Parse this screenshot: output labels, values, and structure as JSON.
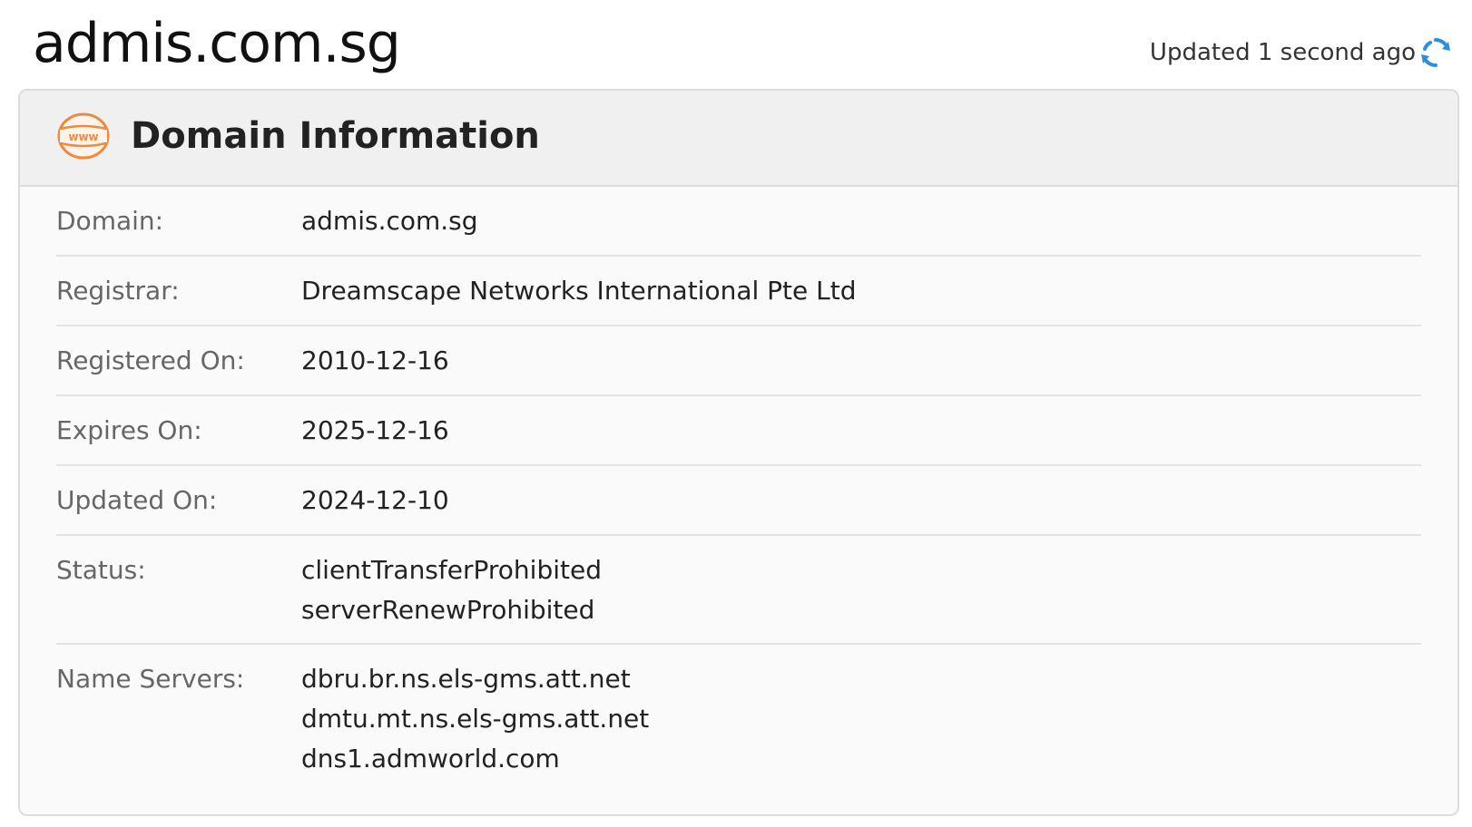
{
  "header": {
    "domain": "admis.com.sg",
    "updated_text": "Updated 1 second ago"
  },
  "card": {
    "title": "Domain Information",
    "icon": "www-globe-icon",
    "icon_text": "www",
    "accent_color": "#f0883e",
    "rows": [
      {
        "label": "Domain:",
        "values": [
          "admis.com.sg"
        ]
      },
      {
        "label": "Registrar:",
        "values": [
          "Dreamscape Networks International Pte Ltd"
        ]
      },
      {
        "label": "Registered On:",
        "values": [
          "2010-12-16"
        ]
      },
      {
        "label": "Expires On:",
        "values": [
          "2025-12-16"
        ]
      },
      {
        "label": "Updated On:",
        "values": [
          "2024-12-10"
        ]
      },
      {
        "label": "Status:",
        "values": [
          "clientTransferProhibited",
          "serverRenewProhibited"
        ]
      },
      {
        "label": "Name Servers:",
        "values": [
          "dbru.br.ns.els-gms.att.net",
          "dmtu.mt.ns.els-gms.att.net",
          "dns1.admworld.com"
        ]
      }
    ]
  },
  "refresh_color": "#2a8fe0"
}
